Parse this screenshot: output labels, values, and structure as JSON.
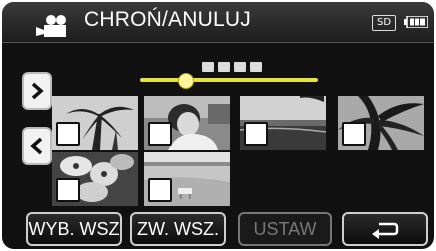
{
  "header": {
    "title": "CHROŃ/ANULUJ",
    "mode_icon": "video-camera-icon",
    "storage_label": "SD",
    "battery_icon": "battery-icon"
  },
  "navigation": {
    "next_icon": "chevron-right-icon",
    "prev_icon": "chevron-left-icon"
  },
  "thumbnails": [
    {
      "checked": false,
      "scene": "palm-tree-silhouette"
    },
    {
      "checked": false,
      "scene": "person-portrait"
    },
    {
      "checked": false,
      "scene": "beach-horizon"
    },
    {
      "checked": false,
      "scene": "palm-leaves-sky"
    },
    {
      "checked": false,
      "scene": "flowers-closeup"
    },
    {
      "checked": false,
      "scene": "sandy-beach"
    }
  ],
  "buttons": {
    "select_all": "WYB. WSZ",
    "deselect_all": "ZW. WSZ.",
    "set": "USTAW",
    "back_icon": "return-arrow-icon"
  },
  "colors": {
    "background": "#111111",
    "scrollbar": "#e8e23c",
    "button_border": "#cfcfcf",
    "disabled": "#777777"
  }
}
